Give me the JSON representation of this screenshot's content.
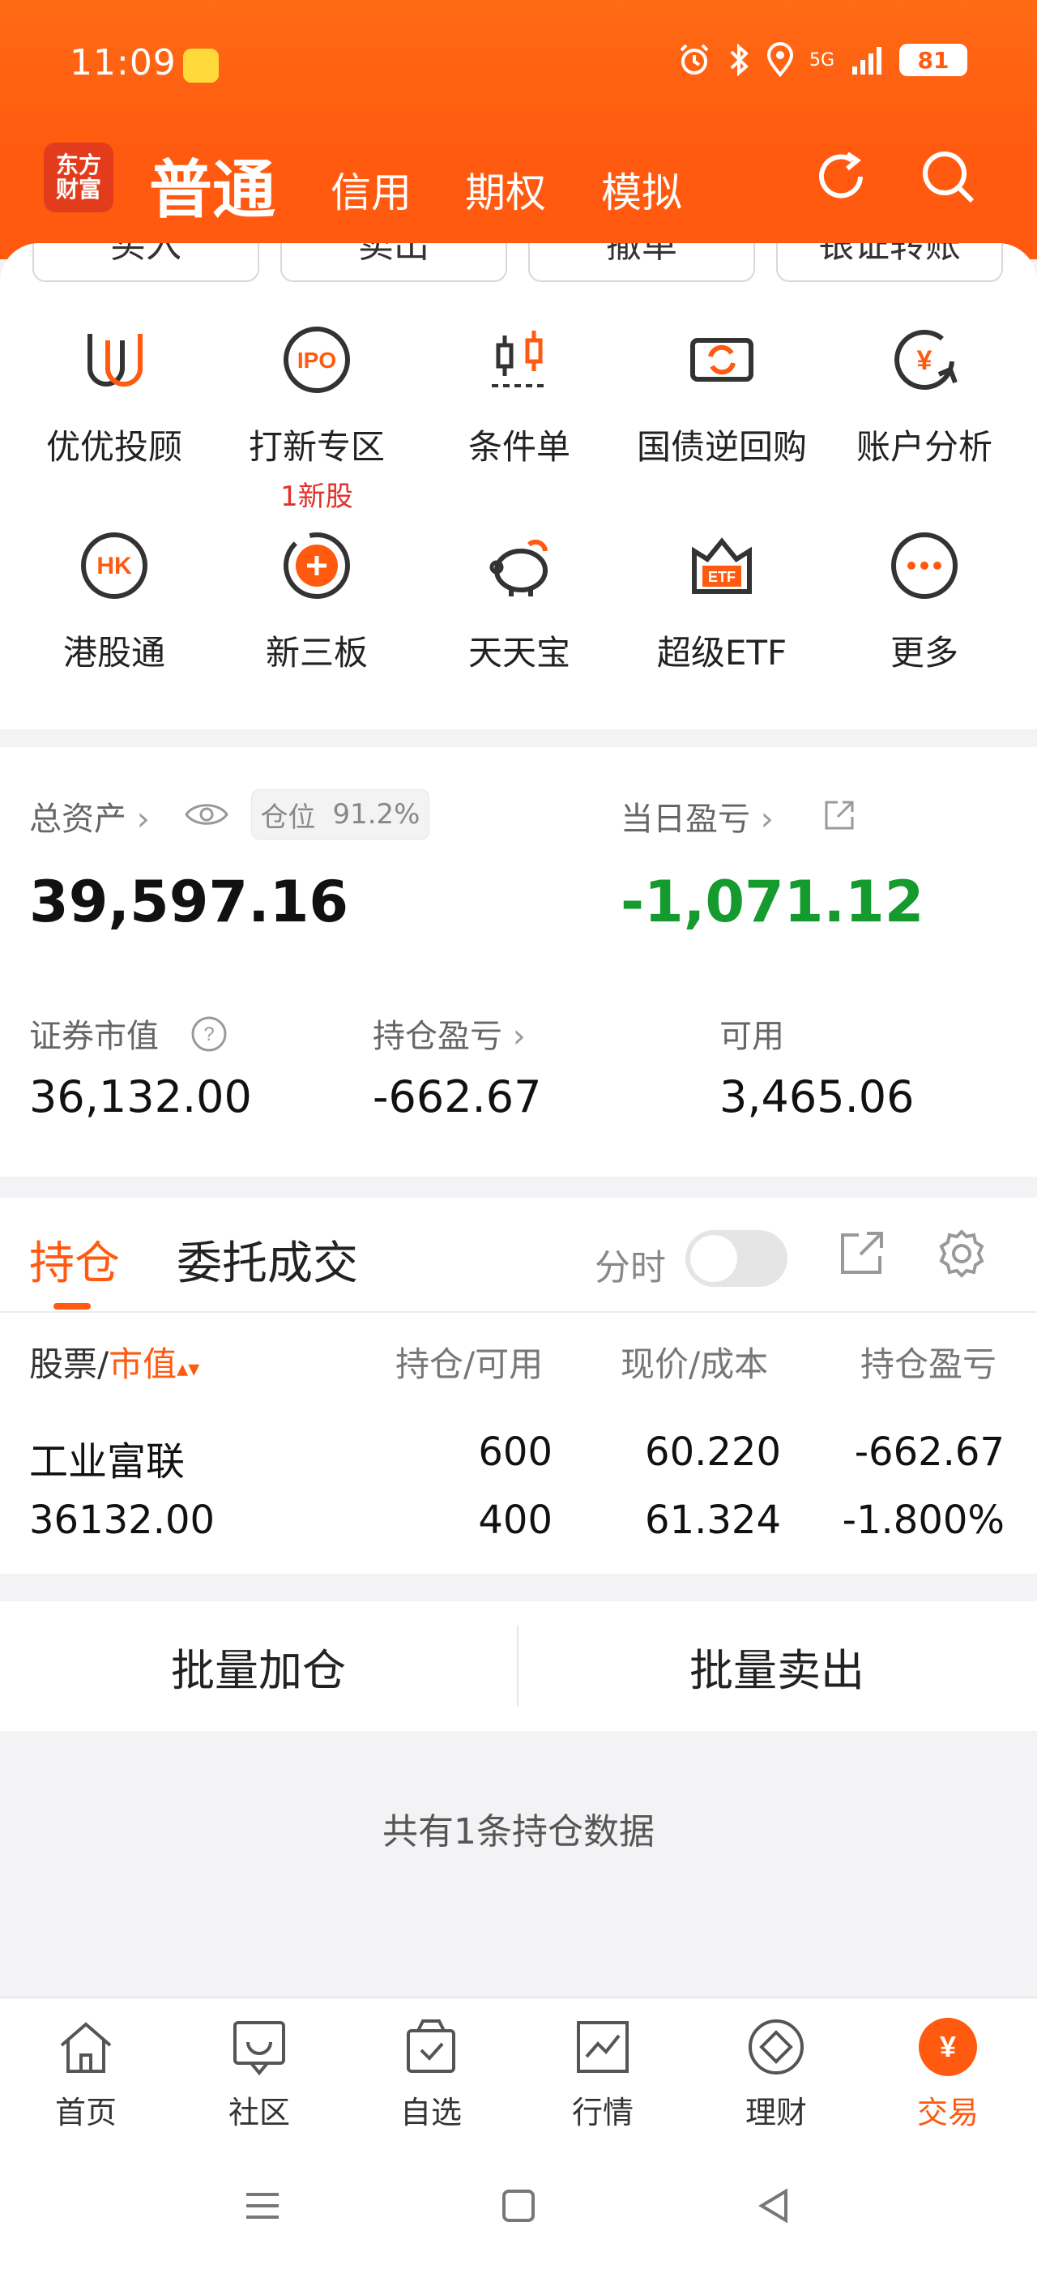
{
  "status_bar": {
    "time": "11:09",
    "network": "5G",
    "battery": "81",
    "icons": [
      "app-notification-icon",
      "alarm-icon",
      "bluetooth-icon",
      "location-icon",
      "signal-icon",
      "battery-icon"
    ]
  },
  "header": {
    "logo_line1": "东方",
    "logo_line2": "财富",
    "tabs": [
      {
        "label": "普通",
        "active": true
      },
      {
        "label": "信用",
        "active": false
      },
      {
        "label": "期权",
        "active": false
      },
      {
        "label": "模拟",
        "active": false
      }
    ],
    "icons": [
      "refresh-icon",
      "search-icon"
    ]
  },
  "quick_actions": [
    {
      "label": "买入"
    },
    {
      "label": "卖出"
    },
    {
      "label": "撤单"
    },
    {
      "label": "银证转账"
    }
  ],
  "function_grid": [
    {
      "label": "优优投顾",
      "icon": "youyou-advisor-icon"
    },
    {
      "label": "打新专区",
      "icon": "ipo-icon",
      "badge": "1新股"
    },
    {
      "label": "条件单",
      "icon": "condition-order-icon"
    },
    {
      "label": "国债逆回购",
      "icon": "reverse-repo-icon"
    },
    {
      "label": "账户分析",
      "icon": "account-analysis-icon"
    },
    {
      "label": "港股通",
      "icon": "hk-connect-icon"
    },
    {
      "label": "新三板",
      "icon": "neeq-icon"
    },
    {
      "label": "天天宝",
      "icon": "piggy-bank-icon"
    },
    {
      "label": "超级ETF",
      "icon": "etf-icon"
    },
    {
      "label": "更多",
      "icon": "more-icon"
    }
  ],
  "assets": {
    "total_label": "总资产",
    "position_label": "仓位",
    "position_value": "91.2%",
    "total_value": "39,597.16",
    "daily_pl_label": "当日盈亏",
    "daily_pl_value": "-1,071.12",
    "market_value_label": "证券市值",
    "market_value": "36,132.00",
    "holding_pl_label": "持仓盈亏",
    "holding_pl_value": "-662.67",
    "available_label": "可用",
    "available_value": "3,465.06"
  },
  "holdings": {
    "tabs": [
      "持仓",
      "委托成交"
    ],
    "timeshare_label": "分时",
    "columns": {
      "stock": "股票/",
      "market_value": "市值",
      "position": "持仓/可用",
      "price": "现价/成本",
      "pl": "持仓盈亏"
    },
    "rows": [
      {
        "name": "工业富联",
        "market_value": "36132.00",
        "shares": "600",
        "available": "400",
        "price": "60.220",
        "cost": "61.324",
        "pl": "-662.67",
        "pl_pct": "-1.800%"
      }
    ]
  },
  "batch": {
    "add": "批量加仓",
    "sell": "批量卖出"
  },
  "footnote": "共有1条持仓数据",
  "bottom_nav": [
    {
      "label": "首页",
      "icon": "home-icon"
    },
    {
      "label": "社区",
      "icon": "community-icon"
    },
    {
      "label": "自选",
      "icon": "watchlist-icon"
    },
    {
      "label": "行情",
      "icon": "market-icon"
    },
    {
      "label": "理财",
      "icon": "wealth-icon"
    },
    {
      "label": "交易",
      "icon": "trade-icon",
      "active": true
    }
  ],
  "colors": {
    "brand_orange": "#ff5a10",
    "loss_green": "#159a2e",
    "badge_red": "#e0302a"
  }
}
